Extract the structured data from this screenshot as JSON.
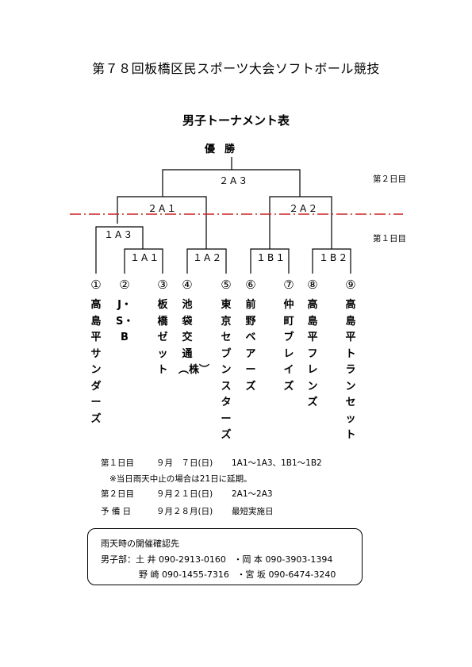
{
  "document": {
    "title": "第７８回板橋区民スポーツ大会ソフトボール競技",
    "subtitle": "男子トーナメント表",
    "champion_label": "優勝"
  },
  "bracket": {
    "matches": {
      "final": "２A３",
      "sf1": "２A１",
      "sf2": "２A２",
      "q13": "１A３",
      "q11": "１A１",
      "q12": "１A２",
      "qb1": "１B１",
      "qb2": "１B２"
    },
    "day_labels": {
      "day2": "第２日目",
      "day1": "第１日目"
    },
    "day_divider_color": "#cc2222"
  },
  "teams": [
    {
      "num": "①",
      "name": "高島平サンダーズ"
    },
    {
      "num": "②",
      "name": "J・S・B"
    },
    {
      "num": "③",
      "name": "板橋ゼット"
    },
    {
      "num": "④",
      "name": "池袋交通︵株︶"
    },
    {
      "num": "⑤",
      "name": "東京セブンスターズ"
    },
    {
      "num": "⑥",
      "name": "前野ベアーズ"
    },
    {
      "num": "⑦",
      "name": "仲町ブレイズ"
    },
    {
      "num": "⑧",
      "name": "高島平フレンズ"
    },
    {
      "num": "⑨",
      "name": "高島平トランセット"
    }
  ],
  "schedule": {
    "day1": {
      "label": "第１日目",
      "date": "９月　７日(日)",
      "matches": "1A1～1A3、1B1～1B2"
    },
    "rain_note": "※当日雨天中止の場合は21日に延期。",
    "day2": {
      "label": "第２日目",
      "date": "９月２１日(日)",
      "matches": "2A1～2A3"
    },
    "reserve": {
      "label": "予 備 日",
      "date": "９月２８月(日)",
      "matches": "最短実施日"
    }
  },
  "contact": {
    "heading": "雨天時の開催確認先",
    "section_label": "男子部：",
    "entries": [
      {
        "name": "土 井",
        "phone": "090-2913-0160"
      },
      {
        "name": "・岡 本",
        "phone": "090-3903-1394"
      },
      {
        "name": "野 崎",
        "phone": "090-1455-7316"
      },
      {
        "name": "・宮 坂",
        "phone": "090-6474-3240"
      }
    ]
  }
}
